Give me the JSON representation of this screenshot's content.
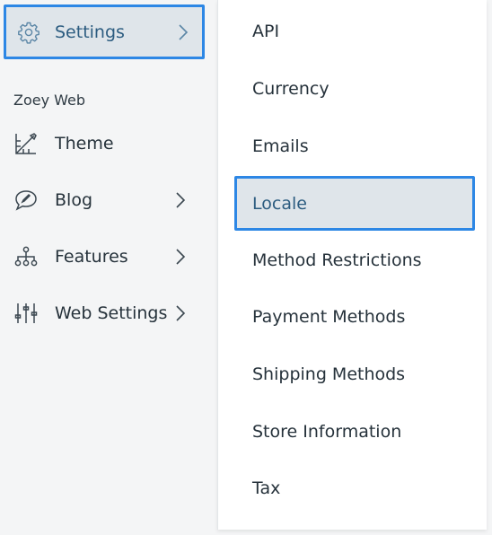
{
  "sidebar": {
    "active_item": {
      "label": "Settings",
      "icon": "gear-icon"
    },
    "section_label": "Zoey Web",
    "items": [
      {
        "label": "Theme",
        "icon": "theme-icon",
        "has_submenu": false
      },
      {
        "label": "Blog",
        "icon": "chat-bubble-icon",
        "has_submenu": true
      },
      {
        "label": "Features",
        "icon": "hierarchy-icon",
        "has_submenu": true
      },
      {
        "label": "Web Settings",
        "icon": "sliders-icon",
        "has_submenu": true
      }
    ]
  },
  "submenu": {
    "items": [
      {
        "label": "API"
      },
      {
        "label": "Currency"
      },
      {
        "label": "Emails"
      },
      {
        "label": "Locale",
        "active": true
      },
      {
        "label": "Method Restrictions"
      },
      {
        "label": "Payment Methods"
      },
      {
        "label": "Shipping Methods"
      },
      {
        "label": "Store Information"
      },
      {
        "label": "Tax"
      }
    ]
  },
  "colors": {
    "accent_border": "#2d87e5",
    "active_bg": "#dfe5ea",
    "active_text": "#2c5c80",
    "sidebar_bg": "#f4f5f6",
    "submenu_bg": "#ffffff"
  }
}
